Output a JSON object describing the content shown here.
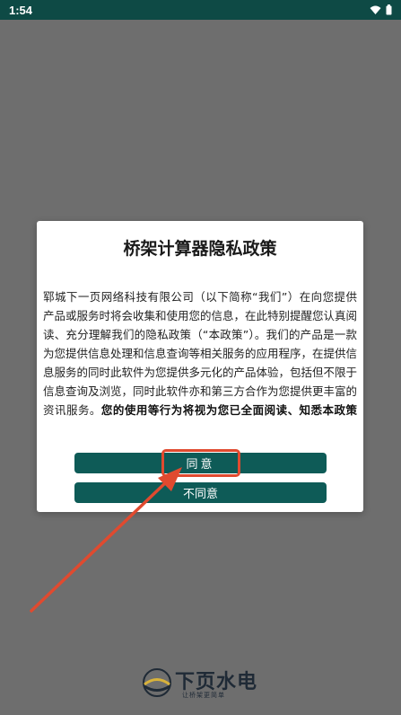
{
  "status_bar": {
    "time": "1:54"
  },
  "dialog": {
    "title": "桥架计算器隐私政策",
    "body_normal": "郓城下一页网络科技有限公司（以下简称“我们”）在向您提供产品或服务时将会收集和使用您的信息，在此特别提醒您认真阅读、充分理解我们的隐私政策（“本政策”）。我们的产品是一款为您提供信息处理和信息查询等相关服务的应用程序，在提供信息服务的同时此软件为您提供多元化的产品体验，包括但不限于信息查询及浏览，同时此软件亦和第三方合作为您提供更丰富的资讯服务。",
    "body_bold": "您的使用等行为将视为您已全面阅读、知悉本政策的内容，并同意做出相应的授权；您同意本政策在您使用此软件的产品和或服务的整个过程有",
    "agree_label": "同意",
    "decline_label": "不同意"
  },
  "watermark": {
    "brand": "下页水电",
    "slogan": "让桥架更简单"
  },
  "colors": {
    "status_bar": "#0e4a45",
    "button": "#0e5b57",
    "annotation": "#e04a2f",
    "overlay": "#6e6e6e"
  }
}
